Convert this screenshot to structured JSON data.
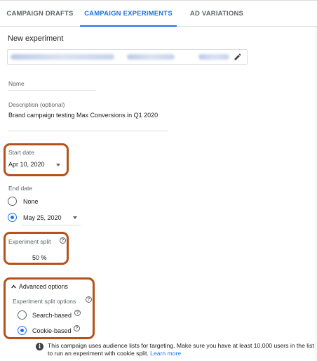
{
  "tabs": [
    {
      "label": "CAMPAIGN DRAFTS",
      "active": false
    },
    {
      "label": "CAMPAIGN EXPERIMENTS",
      "active": true
    },
    {
      "label": "AD VARIATIONS",
      "active": false
    }
  ],
  "page_title": "New experiment",
  "campaign_selector": {
    "edit_icon": "pencil-icon"
  },
  "name_field": {
    "label": "Name",
    "value": ""
  },
  "description_field": {
    "label": "Description (optional)",
    "value": "Brand campaign testing Max Conversions in Q1 2020"
  },
  "start_date": {
    "label": "Start date",
    "value": "Apr 10, 2020"
  },
  "end_date": {
    "label": "End date",
    "options": [
      {
        "label": "None",
        "selected": false
      },
      {
        "label": "May 25, 2020",
        "selected": true
      }
    ]
  },
  "experiment_split": {
    "label": "Experiment split",
    "value": "50 %"
  },
  "advanced_options": {
    "toggle_label": "Advanced options",
    "expanded": true,
    "split_options_label": "Experiment split options",
    "options": [
      {
        "label": "Search-based",
        "selected": false
      },
      {
        "label": "Cookie-based",
        "selected": true
      }
    ]
  },
  "info": {
    "text": "This campaign uses audience lists for targeting. Make sure you have at least 10,000 users in the list to run an experiment with cookie split.",
    "link": "Learn more"
  },
  "colors": {
    "accent": "#1a73e8",
    "highlight": "#b5521c"
  }
}
